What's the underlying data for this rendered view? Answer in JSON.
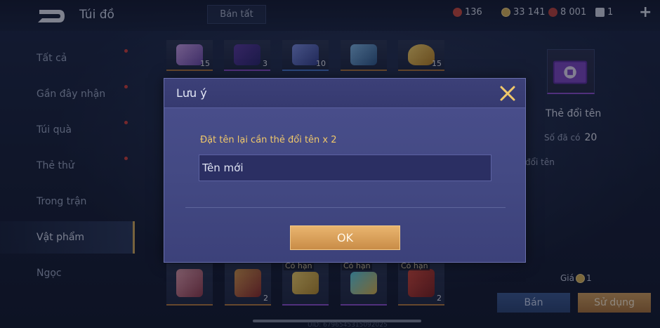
{
  "header": {
    "title": "Túi đồ",
    "sell_all_label": "Bán tất",
    "currencies": [
      {
        "icon": "red-gem-icon",
        "value": "136",
        "color": "#c94a3f"
      },
      {
        "icon": "gold-coin-icon",
        "value": "33 141",
        "color": "#d9b45a"
      },
      {
        "icon": "voucher-icon",
        "value": "8 001",
        "color": "#b9423c"
      },
      {
        "icon": "ticket-icon",
        "value": "1",
        "color": "#cfd6e4"
      }
    ],
    "plus_icon": "plus-icon"
  },
  "sidebar": {
    "items": [
      {
        "label": "Tất cả",
        "dot": true
      },
      {
        "label": "Gần đây nhận",
        "dot": true
      },
      {
        "label": "Túi quà",
        "dot": true
      },
      {
        "label": "Thẻ thử",
        "dot": true
      },
      {
        "label": "Trong trận",
        "dot": false
      },
      {
        "label": "Vật phẩm",
        "dot": false,
        "active": true
      },
      {
        "label": "Ngọc",
        "dot": false
      }
    ]
  },
  "grid": {
    "top_row": [
      {
        "icon": "ticket-item-icon",
        "count": "15"
      },
      {
        "icon": "guitar-item-icon",
        "count": "3"
      },
      {
        "icon": "shield-badge-icon",
        "count": "10"
      },
      {
        "icon": "hero-portrait-icon",
        "count": ""
      },
      {
        "icon": "gold-ingot-icon",
        "count": "15"
      }
    ],
    "bottom_row": [
      {
        "icon": "scroll-item-icon",
        "count": "",
        "limited": ""
      },
      {
        "icon": "emblem-item-icon",
        "count": "2",
        "limited": ""
      },
      {
        "icon": "gold-plate-2025-icon",
        "count": "",
        "limited": "Có hạn"
      },
      {
        "icon": "blue-plate-2025-icon",
        "count": "",
        "limited": "Có hạn"
      },
      {
        "icon": "red-card-icon",
        "count": "2",
        "limited": "Có hạn"
      }
    ]
  },
  "detail": {
    "name": "Thẻ đổi tên",
    "owned_label": "Số đã có",
    "owned_value": "20",
    "description": "đổi tên",
    "price_label": "Giá",
    "price_value": "1",
    "sell_label": "Bán",
    "use_label": "Sử dụng"
  },
  "footer": {
    "uid": "UID: 6796545315092025"
  },
  "dialog": {
    "title": "Lưu ý",
    "message": "Đặt tên lại cần thẻ đổi tên x 2",
    "input_value": "Tên mới",
    "ok_label": "OK"
  }
}
